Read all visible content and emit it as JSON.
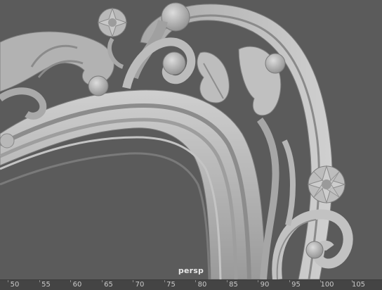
{
  "viewport": {
    "camera": "persp",
    "background": "#5b5b5b",
    "model_color": "#b4b4b4"
  },
  "timeline": {
    "ticks": [
      "50",
      "55",
      "60",
      "65",
      "70",
      "75",
      "80",
      "85",
      "90",
      "95",
      "100",
      "105"
    ]
  }
}
